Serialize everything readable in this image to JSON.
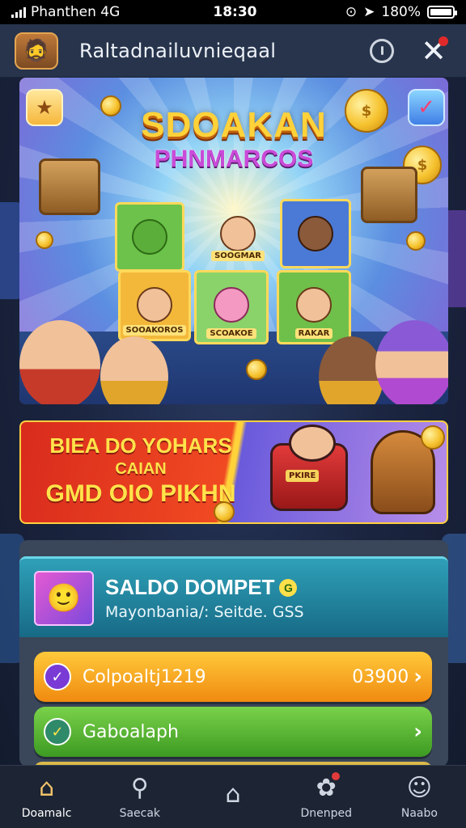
{
  "status_bar": {
    "carrier": "Phanthen 4G",
    "time": "18:30",
    "battery": "180%",
    "battery_level": 1.0
  },
  "header": {
    "title": "Raltadnailuvnieqaal",
    "info_icon": "info-icon",
    "close_icon": "close-icon"
  },
  "hero": {
    "title": "SDOAKAN",
    "subtitle": "PHNMARCOS",
    "card_labels": [
      "SOOGMAR",
      "SOOAKOROS",
      "SCOAKOE",
      "RAKAR"
    ]
  },
  "promo": {
    "line1": "BIEA DO YOHARS",
    "line2": "CAIAN",
    "line3": "GMD OIO PIKHN",
    "robot_tag": "PKIRE"
  },
  "wallet": {
    "title": "SALDO DOMPET",
    "subtitle": "Mayonbania/: Seitde. GSS"
  },
  "actions": [
    {
      "label": "Colpoaltj1219",
      "value": "03900",
      "chevron": "›",
      "color": "#f3a21c"
    },
    {
      "label": "Gaboalaph",
      "value": "",
      "chevron": "›",
      "color": "#55b633"
    }
  ],
  "nav": [
    {
      "label": "Doamalc",
      "icon": "home-icon",
      "glyph": "⌂",
      "active": true
    },
    {
      "label": "Saecak",
      "icon": "search-icon",
      "glyph": "⚲",
      "active": false
    },
    {
      "label": "",
      "icon": "store-icon",
      "glyph": "⌂",
      "active": false
    },
    {
      "label": "Dnenped",
      "icon": "bag-icon",
      "glyph": "✿",
      "active": false
    },
    {
      "label": "Naabo",
      "icon": "profile-icon",
      "glyph": "☺",
      "active": false
    }
  ]
}
